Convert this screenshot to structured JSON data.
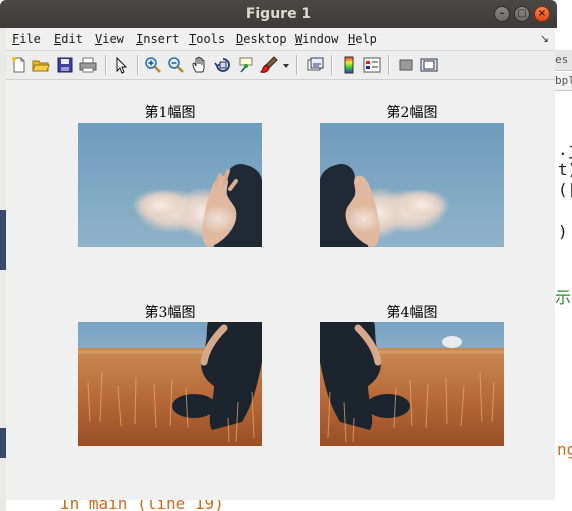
{
  "window": {
    "title": "Figure 1",
    "controls": [
      "minimize",
      "maximize",
      "close"
    ]
  },
  "menubar": {
    "items": [
      {
        "label": "File",
        "underline": "F",
        "rest": "ile"
      },
      {
        "label": "Edit",
        "underline": "E",
        "rest": "dit"
      },
      {
        "label": "View",
        "underline": "V",
        "rest": "iew"
      },
      {
        "label": "Insert",
        "underline": "I",
        "rest": "nsert"
      },
      {
        "label": "Tools",
        "underline": "T",
        "rest": "ools"
      },
      {
        "label": "Desktop",
        "underline": "D",
        "rest": "esktop"
      },
      {
        "label": "Window",
        "underline": "W",
        "rest": "indow"
      },
      {
        "label": "Help",
        "underline": "H",
        "rest": "elp"
      }
    ],
    "dock_glyph": "↘"
  },
  "toolbar": {
    "buttons": [
      "new-figure",
      "open-file",
      "save",
      "print",
      "edit-plot-arrow",
      "zoom-in",
      "zoom-out",
      "pan",
      "rotate-3d",
      "data-cursor",
      "brush",
      "brush-dropdown",
      "link-plot",
      "colorbar",
      "legend",
      "hide-plot-tools",
      "show-plot-tools"
    ]
  },
  "axes": [
    {
      "title": "第1幅图",
      "image": "hand-throwing-powder"
    },
    {
      "title": "第2幅图",
      "image": "hand-throwing-powder-mirrored"
    },
    {
      "title": "第3幅图",
      "image": "person-in-wheat-field"
    },
    {
      "title": "第4幅图",
      "image": "person-in-wheat-field-mirrored"
    }
  ],
  "background_editor": {
    "right_tab_1": "es",
    "right_tab_2": "bpl",
    "code_fragments": [
      ".j",
      "t)",
      "([",
      ")"
    ],
    "green_fragment": "示",
    "orange_fragment": "ng",
    "bottom_line": "In main  (line 19)"
  },
  "colors": {
    "titlebar": "#3f3e3a",
    "close_button": "#e9581f",
    "canvas": "#f0f0f0"
  }
}
